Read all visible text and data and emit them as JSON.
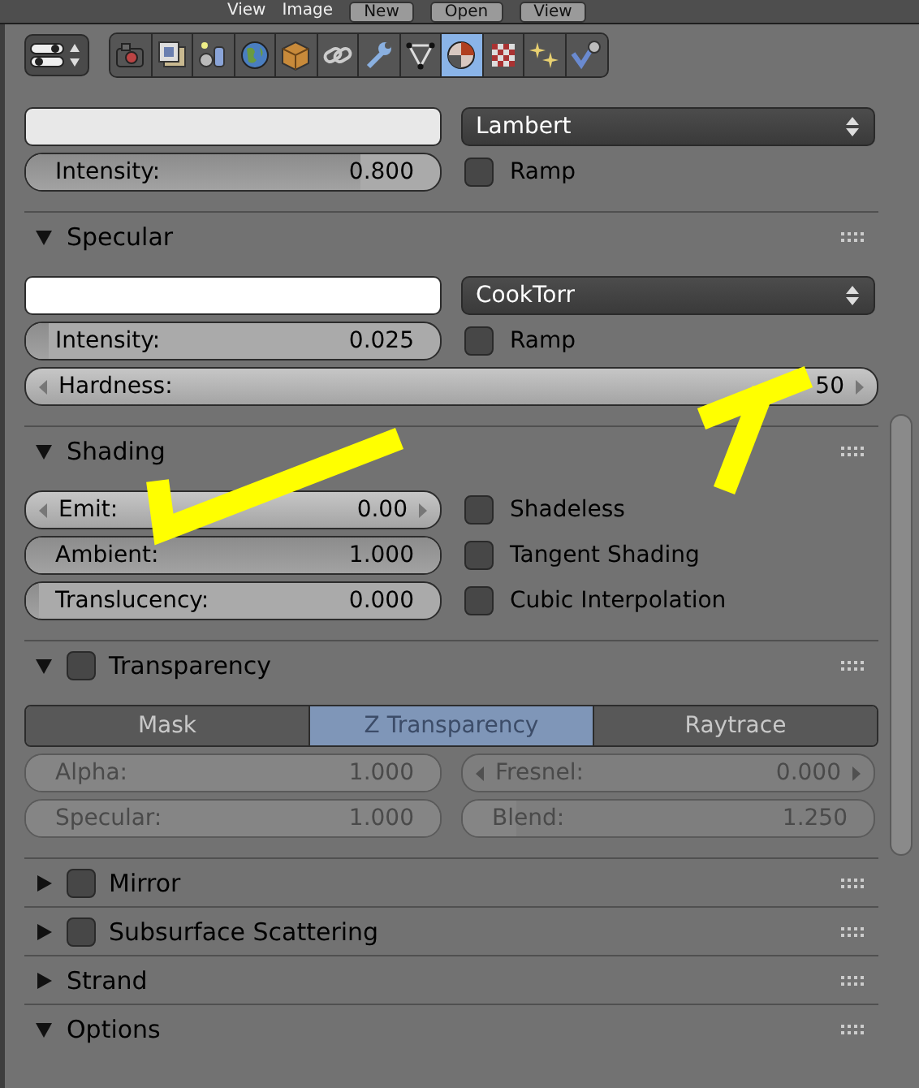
{
  "header": {
    "items": [
      {
        "kind": "menu",
        "label": "View"
      },
      {
        "kind": "menu",
        "label": "Image"
      },
      {
        "kind": "button",
        "label": "New"
      },
      {
        "kind": "button",
        "label": "Open"
      },
      {
        "kind": "dropdown",
        "label": "View"
      }
    ]
  },
  "context_tabs": [
    {
      "selected": false
    },
    {
      "selected": false
    },
    {
      "selected": false
    },
    {
      "selected": false
    },
    {
      "selected": false
    },
    {
      "selected": false
    },
    {
      "selected": false
    },
    {
      "selected": false
    },
    {
      "selected": true
    },
    {
      "selected": false
    },
    {
      "selected": false
    },
    {
      "selected": false
    }
  ],
  "panels": [
    {
      "rows": [
        {
          "kind": "pair",
          "cells": [
            {
              "kind": "swatch",
              "color": "#e8e8e8"
            },
            {
              "kind": "dropdown",
              "value": "Lambert"
            }
          ]
        },
        {
          "kind": "pair",
          "cells": [
            {
              "kind": "slider",
              "label": "Intensity:",
              "value": "0.800",
              "level": 0.8
            },
            {
              "kind": "checkbox",
              "label": "Ramp",
              "checked": false
            }
          ]
        }
      ]
    },
    {
      "title": "Specular",
      "expanded": true,
      "rows": [
        {
          "kind": "pair",
          "cells": [
            {
              "kind": "swatch",
              "color": "#ffffff"
            },
            {
              "kind": "dropdown",
              "value": "CookTorr"
            }
          ]
        },
        {
          "kind": "pair",
          "cells": [
            {
              "kind": "slider",
              "label": "Intensity:",
              "value": "0.025",
              "level": 0.025
            },
            {
              "kind": "checkbox",
              "label": "Ramp",
              "checked": false
            }
          ]
        },
        {
          "kind": "full",
          "cells": [
            {
              "kind": "number",
              "label": "Hardness:",
              "value": "50"
            }
          ]
        }
      ]
    },
    {
      "title": "Shading",
      "expanded": true,
      "rows": [
        {
          "kind": "pair",
          "cells": [
            {
              "kind": "number",
              "label": "Emit:",
              "value": "0.00"
            },
            {
              "kind": "checkbox",
              "label": "Shadeless",
              "checked": false
            }
          ]
        },
        {
          "kind": "pair",
          "cells": [
            {
              "kind": "slider",
              "label": "Ambient:",
              "value": "1.000",
              "level": 1
            },
            {
              "kind": "checkbox",
              "label": "Tangent Shading",
              "checked": false
            }
          ]
        },
        {
          "kind": "pair",
          "cells": [
            {
              "kind": "slider",
              "label": "Translucency:",
              "value": "0.000",
              "level": 0
            },
            {
              "kind": "checkbox",
              "label": "Cubic Interpolation",
              "checked": false
            }
          ]
        }
      ]
    },
    {
      "title": "Transparency",
      "checked": false,
      "expanded": true,
      "rows": [
        {
          "kind": "segmented",
          "options": [
            {
              "label": "Mask",
              "selected": false
            },
            {
              "label": "Z Transparency",
              "selected": true
            },
            {
              "label": "Raytrace",
              "selected": false
            }
          ]
        },
        {
          "kind": "pair",
          "cells": [
            {
              "kind": "slider",
              "label": "Alpha:",
              "value": "1.000",
              "level": 1,
              "disabled": true
            },
            {
              "kind": "number",
              "label": "Fresnel:",
              "value": "0.000",
              "disabled": true
            }
          ]
        },
        {
          "kind": "pair",
          "cells": [
            {
              "kind": "slider",
              "label": "Specular:",
              "value": "1.000",
              "level": 1,
              "disabled": true
            },
            {
              "kind": "slider",
              "label": "Blend:",
              "value": "1.250",
              "level": 0.1,
              "disabled": true
            }
          ]
        }
      ]
    },
    {
      "title": "Mirror",
      "checked": false,
      "expanded": false
    },
    {
      "title": "Subsurface Scattering",
      "checked": false,
      "expanded": false
    },
    {
      "title": "Strand",
      "expanded": false
    },
    {
      "title": "Options",
      "expanded": true
    }
  ],
  "annotations": [
    {
      "kind": "arrow"
    },
    {
      "kind": "arrow"
    }
  ]
}
